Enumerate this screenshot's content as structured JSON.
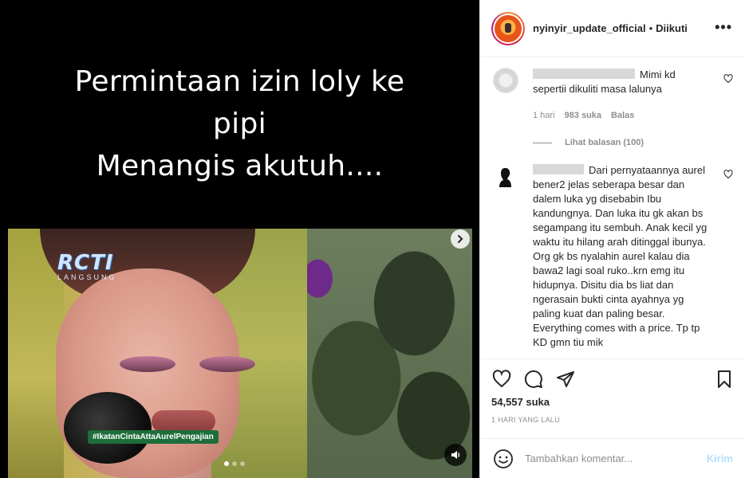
{
  "media": {
    "caption_lines": [
      "Permintaan izin loly ke",
      "pipi",
      "Menangis akutuh...."
    ],
    "channel_logo": "RCTI",
    "channel_sub": "LANGSUNG",
    "hashtag": "#IkatanCintaAttaAurelPengajian",
    "carousel_dots": 3,
    "active_dot": 0
  },
  "post": {
    "username": "nyinyir_update_official",
    "separator": "•",
    "follow_status": "Diikuti",
    "more_icon": "more-horizontal-icon"
  },
  "comments": [
    {
      "text": "Mimi kd sepertii dikuliti masa lalunya",
      "time": "1 hari",
      "likes": "983 suka",
      "reply": "Balas",
      "view_replies": "Lihat balasan (100)"
    },
    {
      "text": "Dari pernyataannya aurel bener2 jelas seberapa besar dan dalem luka yg disebabin Ibu kandungnya. Dan luka itu gk akan bs segampang itu sembuh. Anak kecil yg waktu itu hilang arah ditinggal ibunya. Org gk bs nyalahin aurel kalau dia bawa2 lagi soal ruko..krn emg itu hidupnya. Disitu dia bs liat dan ngerasain bukti cinta ayahnya yg paling kuat dan paling besar. Everything comes with a price. Tp tp KD gmn tiu mik"
    }
  ],
  "actions": {
    "likes": "54,557 suka",
    "time": "1 HARI YANG LALU"
  },
  "composer": {
    "placeholder": "Tambahkan komentar...",
    "post_label": "Kirim"
  },
  "colors": {
    "post_button_disabled": "#b2dffc",
    "secondary_text": "#8e8e8e",
    "primary_text": "#262626"
  }
}
